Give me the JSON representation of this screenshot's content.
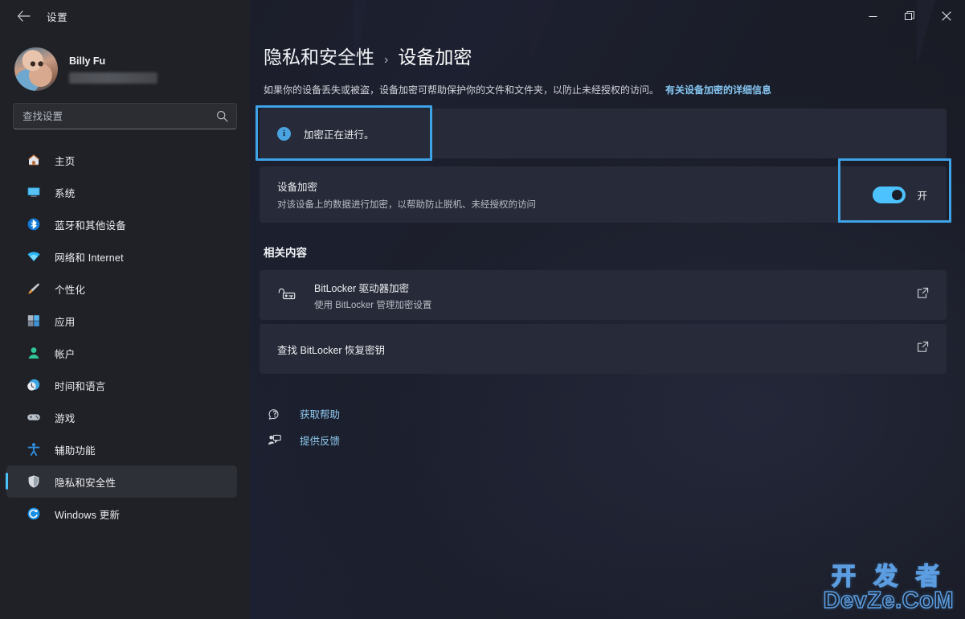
{
  "titlebar": {
    "back_icon": "back-arrow-icon",
    "title": "设置",
    "minimize_icon": "minimize-icon",
    "maximize_icon": "maximize-icon",
    "close_icon": "close-icon"
  },
  "sidebar": {
    "profile": {
      "name": "Billy Fu",
      "email_redacted": ""
    },
    "search": {
      "placeholder": "查找设置",
      "value": "",
      "icon": "search-icon"
    },
    "items": [
      {
        "label": "主页",
        "icon": "home-icon",
        "active": false
      },
      {
        "label": "系统",
        "icon": "system-icon",
        "active": false
      },
      {
        "label": "蓝牙和其他设备",
        "icon": "bluetooth-icon",
        "active": false
      },
      {
        "label": "网络和 Internet",
        "icon": "network-icon",
        "active": false
      },
      {
        "label": "个性化",
        "icon": "personalization-brush-icon",
        "active": false
      },
      {
        "label": "应用",
        "icon": "apps-icon",
        "active": false
      },
      {
        "label": "帐户",
        "icon": "accounts-icon",
        "active": false
      },
      {
        "label": "时间和语言",
        "icon": "time-language-icon",
        "active": false
      },
      {
        "label": "游戏",
        "icon": "gaming-controller-icon",
        "active": false
      },
      {
        "label": "辅助功能",
        "icon": "accessibility-icon",
        "active": false
      },
      {
        "label": "隐私和安全性",
        "icon": "privacy-shield-icon",
        "active": true
      },
      {
        "label": "Windows 更新",
        "icon": "windows-update-icon",
        "active": false
      }
    ]
  },
  "main": {
    "breadcrumb": {
      "parent": "隐私和安全性",
      "separator": "›",
      "current": "设备加密"
    },
    "description": "如果你的设备丢失或被盗，设备加密可帮助保护你的文件和文件夹，以防止未经授权的访问。",
    "description_link": "有关设备加密的详细信息",
    "info_banner": {
      "icon": "info-circle-icon",
      "text": "加密正在进行。"
    },
    "encryption_row": {
      "title": "设备加密",
      "subtitle": "对该设备上的数据进行加密，以帮助防止脱机、未经授权的访问",
      "toggle_state": "on",
      "toggle_label": "开"
    },
    "related_section_title": "相关内容",
    "related_items": [
      {
        "title": "BitLocker 驱动器加密",
        "subtitle": "使用 BitLocker 管理加密设置",
        "icon": "bitlocker-drive-icon",
        "action_icon": "external-link-icon"
      },
      {
        "title": "查找 BitLocker 恢复密钥",
        "subtitle": "",
        "icon": "",
        "action_icon": "external-link-icon"
      }
    ],
    "footer_links": [
      {
        "label": "获取帮助",
        "icon": "help-icon"
      },
      {
        "label": "提供反馈",
        "icon": "feedback-icon"
      }
    ]
  },
  "annotations": {
    "highlight_color": "#3fa3e8",
    "boxes": [
      "info-banner-highlight",
      "toggle-highlight"
    ]
  },
  "watermark": {
    "line1": "开 发 者",
    "line2": "DevZe.CoM",
    "color": "#5b9de0"
  },
  "colors": {
    "accent": "#4cc2ff",
    "card": "#272a38",
    "sidebar": "#202126",
    "link": "#86c7f3"
  }
}
